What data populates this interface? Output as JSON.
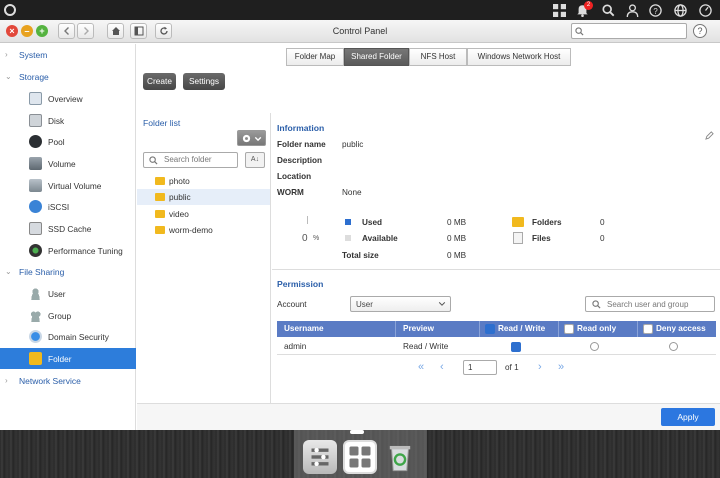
{
  "window": {
    "title": "Control Panel"
  },
  "topbar": {
    "notification_count": "2"
  },
  "sidebar": {
    "sections": {
      "system": "System",
      "storage": "Storage",
      "file_sharing": "File Sharing",
      "network_service": "Network Service"
    },
    "storage_items": [
      "Overview",
      "Disk",
      "Pool",
      "Volume",
      "Virtual Volume",
      "iSCSI",
      "SSD Cache",
      "Performance Tuning"
    ],
    "sharing_items": [
      "User",
      "Group",
      "Domain Security",
      "Folder"
    ]
  },
  "tabs": [
    "Folder Map",
    "Shared Folder",
    "NFS Host",
    "Windows Network Host"
  ],
  "actions": {
    "create": "Create",
    "settings": "Settings"
  },
  "folder_list": {
    "title": "Folder list",
    "search_placeholder": "Search folder",
    "folders": [
      "photo",
      "public",
      "video",
      "worm-demo"
    ]
  },
  "information": {
    "title": "Information",
    "folder_name_label": "Folder name",
    "folder_name": "public",
    "description_label": "Description",
    "location_label": "Location",
    "worm_label": "WORM",
    "worm": "None",
    "usage_percent": "0",
    "usage_unit": "%",
    "used_label": "Used",
    "used": "0 MB",
    "available_label": "Available",
    "available": "0 MB",
    "total_label": "Total size",
    "total": "0 MB",
    "folders_label": "Folders",
    "folders": "0",
    "files_label": "Files",
    "files": "0"
  },
  "permission": {
    "title": "Permission",
    "account_label": "Account",
    "account_value": "User",
    "search_placeholder": "Search user and group",
    "columns": [
      "Username",
      "Preview",
      "Read / Write",
      "Read only",
      "Deny access"
    ],
    "rows": [
      {
        "username": "admin",
        "preview": "Read / Write",
        "read_write": true,
        "read_only": false,
        "deny": false
      }
    ],
    "page": "1",
    "of_label": "of 1"
  },
  "footer": {
    "apply": "Apply"
  },
  "colors": {
    "accent": "#2d7ddb",
    "header": "#5a7bc4",
    "folder": "#f1b91e"
  }
}
